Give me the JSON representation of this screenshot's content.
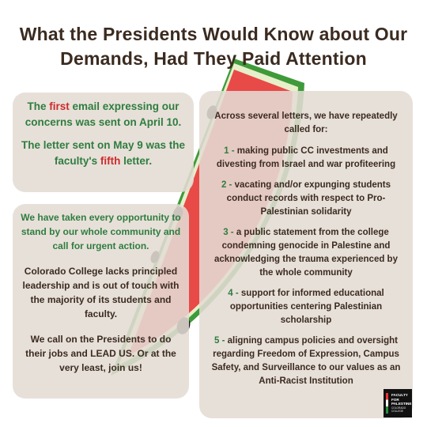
{
  "title": {
    "line1": "What the Presidents Would Know about Our",
    "line2": "Demands, Had They Paid Attention"
  },
  "colors": {
    "title": "#3b2b20",
    "green": "#2f7d3f",
    "red": "#cc2a2a",
    "watermelon_red": "#e84a48",
    "rind_green": "#3f9a3a",
    "seed": "#1e1e1e",
    "card": "#e4dcd4"
  },
  "top_card": {
    "p1_a": "The ",
    "p1_highlight": "first",
    "p1_b": " email expressing our concerns was sent on April 10.",
    "p2_a": "The letter sent on May 9 was the faculty's ",
    "p2_highlight": "fifth",
    "p2_b": " letter."
  },
  "left_card": {
    "p1": "We have taken every opportunity to stand by our whole community and call for urgent action.",
    "p2": "Colorado College lacks principled leadership and is out of touch with the majority of its students and faculty.",
    "p3": "We call on the Presidents to do their jobs and LEAD US. Or at the very least, join us!"
  },
  "right_card": {
    "intro": "Across several letters, we have repeatedly called for:",
    "items": [
      {
        "num": "1 - ",
        "text": "making public CC investments and divesting from Israel and war profiteering"
      },
      {
        "num": "2 - ",
        "text": "vacating and/or expunging students conduct records with respect to Pro-Palestinian solidarity"
      },
      {
        "num": "3 - ",
        "text": "a public statement from the college condemning genocide in Palestine and acknowledging the trauma experienced by the whole community"
      },
      {
        "num": "4 - ",
        "text": "support for informed educational opportunities centering Palestinian scholarship"
      },
      {
        "num": "5 - ",
        "text": "aligning campus policies and oversight regarding Freedom of Expression, Campus Safety, and Surveillance to our values as an Anti-Racist Institution"
      }
    ]
  },
  "logo": {
    "line1": "FACULTY",
    "line2": "FOR",
    "line3": "PALESTINE",
    "line4": "COLORADO",
    "line5": "COLLEGE"
  }
}
